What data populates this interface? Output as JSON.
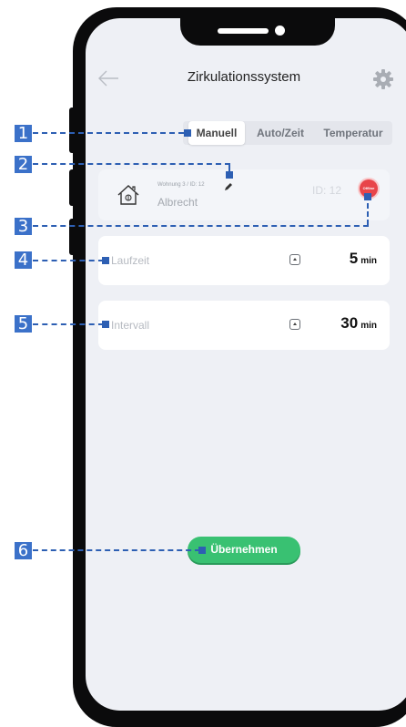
{
  "header": {
    "title": "Zirkulationssystem",
    "back_icon": "arrow-left-icon",
    "settings_icon": "gear-icon"
  },
  "tabs": [
    {
      "label": "Manuell",
      "active": true
    },
    {
      "label": "Auto/Zeit",
      "active": false
    },
    {
      "label": "Temperatur",
      "active": false
    }
  ],
  "device": {
    "subtitle": "Wohnung 3 / ID: 12",
    "name": "Albrecht",
    "id_label": "ID: 12",
    "status": "Offline",
    "status_color": "#e8454a"
  },
  "settings": [
    {
      "label": "Laufzeit",
      "value": "5",
      "unit": "min"
    },
    {
      "label": "Intervall",
      "value": "30",
      "unit": "min"
    }
  ],
  "submit_label": "Übernehmen",
  "accent_color": "#39c172",
  "callouts": [
    "1",
    "2",
    "3",
    "4",
    "5",
    "6"
  ]
}
